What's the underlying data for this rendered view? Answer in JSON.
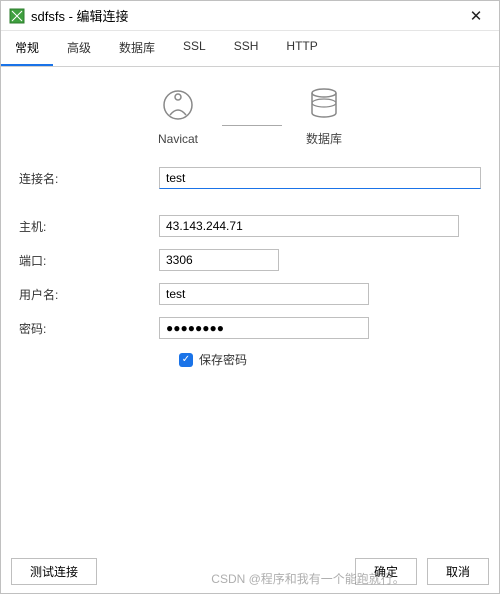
{
  "window": {
    "title": "sdfsfs - 编辑连接"
  },
  "tabs": [
    "常规",
    "高级",
    "数据库",
    "SSL",
    "SSH",
    "HTTP"
  ],
  "diagram": {
    "left_label": "Navicat",
    "right_label": "数据库"
  },
  "fields": {
    "name_label": "连接名:",
    "name_value": "test",
    "host_label": "主机:",
    "host_value": "43.143.244.71",
    "port_label": "端口:",
    "port_value": "3306",
    "user_label": "用户名:",
    "user_value": "test",
    "password_label": "密码:",
    "password_value": "●●●●●●●●",
    "save_password_label": "保存密码"
  },
  "buttons": {
    "test": "测试连接",
    "ok": "确定",
    "cancel": "取消"
  },
  "watermark": "CSDN @程序和我有一个能跑就行。"
}
